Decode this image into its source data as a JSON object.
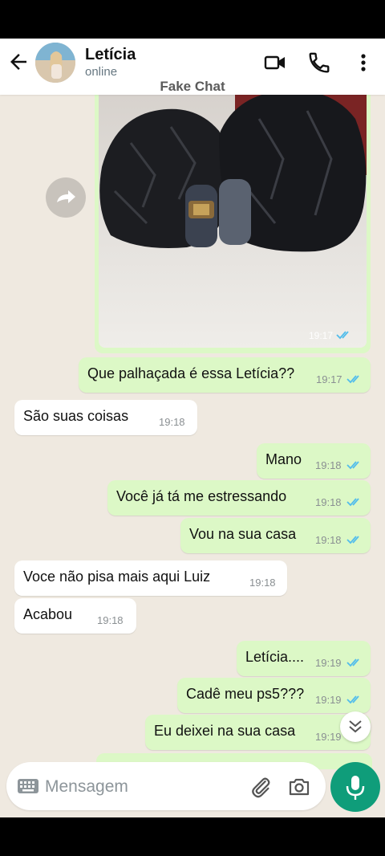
{
  "contact": {
    "name": "Letícia",
    "status": "online"
  },
  "watermark": "Fake Chat",
  "icons": {
    "back": "arrow-left-icon",
    "video": "video-camera-icon",
    "call": "phone-icon",
    "menu": "more-vert-icon",
    "forward": "forward-icon",
    "keyboard": "keyboard-icon",
    "attach": "paperclip-icon",
    "camera": "camera-icon",
    "mic": "microphone-icon",
    "scroll_down": "double-chevron-down-icon"
  },
  "colors": {
    "outgoing": "#dcf8c6",
    "incoming": "#ffffff",
    "ticks": "#53bdeb",
    "accent": "#0f9d7a"
  },
  "image_message": {
    "time": "19:17",
    "read": true
  },
  "messages": [
    {
      "dir": "out",
      "text": "Que palhaçada é essa Letícia??",
      "time": "19:17",
      "read": true
    },
    {
      "dir": "in",
      "text": "São suas coisas",
      "time": "19:18"
    },
    {
      "dir": "out",
      "text": "Mano",
      "time": "19:18",
      "read": true
    },
    {
      "dir": "out",
      "text": "Você já tá me estressando",
      "time": "19:18",
      "read": true
    },
    {
      "dir": "out",
      "text": "Vou na sua casa",
      "time": "19:18",
      "read": true
    },
    {
      "dir": "in",
      "text": "Voce não pisa mais aqui Luiz",
      "time": "19:18"
    },
    {
      "dir": "in",
      "text": "Acabou",
      "time": "19:18"
    },
    {
      "dir": "out",
      "text": "Letícia....",
      "time": "19:19",
      "read": true
    },
    {
      "dir": "out",
      "text": "Cadê meu ps5???",
      "time": "19:19",
      "read": true
    },
    {
      "dir": "out",
      "text": "Eu deixei na sua casa",
      "time": "19:19",
      "read": true
    }
  ],
  "composer": {
    "placeholder": "Mensagem"
  }
}
